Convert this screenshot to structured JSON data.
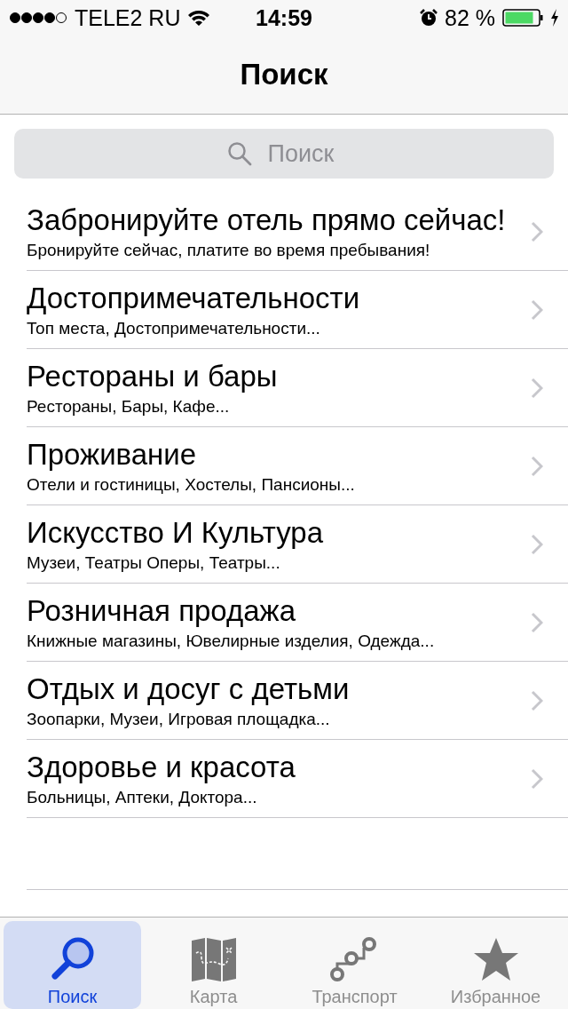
{
  "status_bar": {
    "carrier": "TELE2 RU",
    "time": "14:59",
    "battery": "82 %"
  },
  "nav_bar": {
    "title": "Поиск"
  },
  "search": {
    "placeholder": "Поиск"
  },
  "categories": [
    {
      "title": "Забронируйте отель прямо сейчас!",
      "subtitle": "Бронируйте сейчас, платите во время пребывания!"
    },
    {
      "title": "Достопримечательности",
      "subtitle": "Топ места, Достопримечательности..."
    },
    {
      "title": "Рестораны и бары",
      "subtitle": "Рестораны, Бары, Кафе..."
    },
    {
      "title": "Проживание",
      "subtitle": "Отели и гостиницы, Хостелы, Пансионы..."
    },
    {
      "title": "Искусство И Культура",
      "subtitle": "Музеи, Театры Оперы, Театры..."
    },
    {
      "title": "Розничная продажа",
      "subtitle": "Книжные магазины, Ювелирные изделия, Одежда..."
    },
    {
      "title": "Отдых и досуг с детьми",
      "subtitle": "Зоопарки, Музеи, Игровая площадка..."
    },
    {
      "title": "Здоровье и красота",
      "subtitle": "Больницы, Аптеки, Доктора..."
    }
  ],
  "tab_bar": [
    {
      "kind": "search",
      "label": "Поиск",
      "selected": true
    },
    {
      "kind": "map",
      "label": "Карта",
      "selected": false
    },
    {
      "kind": "route",
      "label": "Транспорт",
      "selected": false
    },
    {
      "kind": "star",
      "label": "Избранное",
      "selected": false
    }
  ]
}
